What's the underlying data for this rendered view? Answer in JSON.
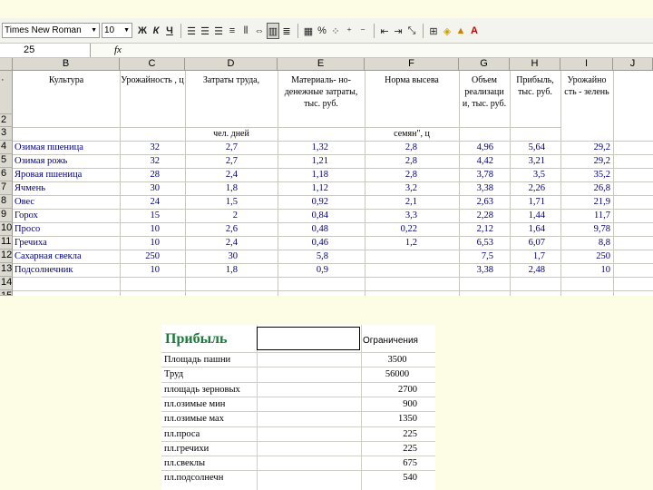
{
  "toolbar": {
    "font_name": "Times New Roman",
    "font_size": "10",
    "icons": [
      "bold-icon",
      "italic-icon",
      "underline-icon",
      "align-left-icon",
      "align-center-icon",
      "align-right-icon",
      "justify-icon",
      "distributed-icon",
      "merge-center-icon",
      "indent-icon",
      "currency-icon",
      "percent-icon",
      "comma-style-icon",
      "increase-decimal-icon",
      "decrease-decimal-icon",
      "decrease-indent-icon",
      "increase-indent-icon",
      "text-direction-icon",
      "borders-icon",
      "fill-color-icon",
      "font-color-icon"
    ],
    "glyphs": {
      "bold": "Ж",
      "italic": "К",
      "underline": "Ч",
      "percent": "%"
    }
  },
  "formula_bar": {
    "name_box": "25",
    "fx": "fx"
  },
  "sheet": {
    "columns": [
      "B",
      "C",
      "D",
      "E",
      "F",
      "G",
      "H",
      "I",
      "J"
    ],
    "rows": [
      "1",
      "2",
      "3",
      "4",
      "5",
      "6",
      "7",
      "8",
      "9",
      "10",
      "11",
      "12",
      "13",
      "14",
      "15"
    ],
    "headers": {
      "culture": "Культура",
      "yield": "Урожайность , ц",
      "labor": "Затраты труда,",
      "material": "Материаль- но-денежные затраты, тыс. руб.",
      "seed": "Норма высева",
      "sales": "Объем реализаци и, тыс. руб.",
      "profit": "Прибыль, тыс. руб.",
      "yield2": "Урожайно сть - зелень"
    },
    "units": {
      "labor": "чел. дней",
      "seed": "семян\", ц"
    },
    "data_rows": [
      {
        "name": "Озимая пшеница",
        "yield": "32",
        "labor": "2,7",
        "material": "1,32",
        "seed": "2,8",
        "sales": "4,96",
        "profit": "5,64",
        "y2": "29,2"
      },
      {
        "name": "Озимая рожь",
        "yield": "32",
        "labor": "2,7",
        "material": "1,21",
        "seed": "2,8",
        "sales": "4,42",
        "profit": "3,21",
        "y2": "29,2"
      },
      {
        "name": "Яровая пшеница",
        "yield": "28",
        "labor": "2,4",
        "material": "1,18",
        "seed": "2,8",
        "sales": "3,78",
        "profit": "3,5",
        "y2": "35,2"
      },
      {
        "name": "Ячмень",
        "yield": "30",
        "labor": "1,8",
        "material": "1,12",
        "seed": "3,2",
        "sales": "3,38",
        "profit": "2,26",
        "y2": "26,8"
      },
      {
        "name": "Овес",
        "yield": "24",
        "labor": "1,5",
        "material": "0,92",
        "seed": "2,1",
        "sales": "2,63",
        "profit": "1,71",
        "y2": "21,9"
      },
      {
        "name": "Горох",
        "yield": "15",
        "labor": "2",
        "material": "0,84",
        "seed": "3,3",
        "sales": "2,28",
        "profit": "1,44",
        "y2": "11,7"
      },
      {
        "name": "Просо",
        "yield": "10",
        "labor": "2,6",
        "material": "0,48",
        "seed": "0,22",
        "sales": "2,12",
        "profit": "1,64",
        "y2": "9,78"
      },
      {
        "name": "Гречиха",
        "yield": "10",
        "labor": "2,4",
        "material": "0,46",
        "seed": "1,2",
        "sales": "6,53",
        "profit": "6,07",
        "y2": "8,8"
      },
      {
        "name": "Сахарная свекла",
        "yield": "250",
        "labor": "30",
        "material": "5,8",
        "seed": "",
        "sales": "7,5",
        "profit": "1,7",
        "y2": "250"
      },
      {
        "name": "Подсолнечник",
        "yield": "10",
        "labor": "1,8",
        "material": "0,9",
        "seed": "",
        "sales": "3,38",
        "profit": "2,48",
        "y2": "10"
      }
    ]
  },
  "constraints": {
    "title": "Прибыль",
    "column_header": "Ограничения",
    "rows": [
      {
        "label": "Площадь пашни",
        "value": "3500",
        "align": "center"
      },
      {
        "label": "Труд",
        "value": "56000",
        "align": "center"
      },
      {
        "label": "площадь зерновых",
        "value": "2700",
        "align": "right"
      },
      {
        "label": "пл.озимые мин",
        "value": "900",
        "align": "right"
      },
      {
        "label": "пл.озимые мах",
        "value": "1350",
        "align": "right"
      },
      {
        "label": "пл.проса",
        "value": "225",
        "align": "right"
      },
      {
        "label": "пл.гречихи",
        "value": "225",
        "align": "right"
      },
      {
        "label": "пл.свеклы",
        "value": "675",
        "align": "right"
      },
      {
        "label": "пл.подсолнечн",
        "value": "540",
        "align": "right"
      }
    ]
  },
  "colors": {
    "data_text": "#00007a",
    "title_text": "#1a7a3a",
    "page_bg": "#fdfde6"
  }
}
